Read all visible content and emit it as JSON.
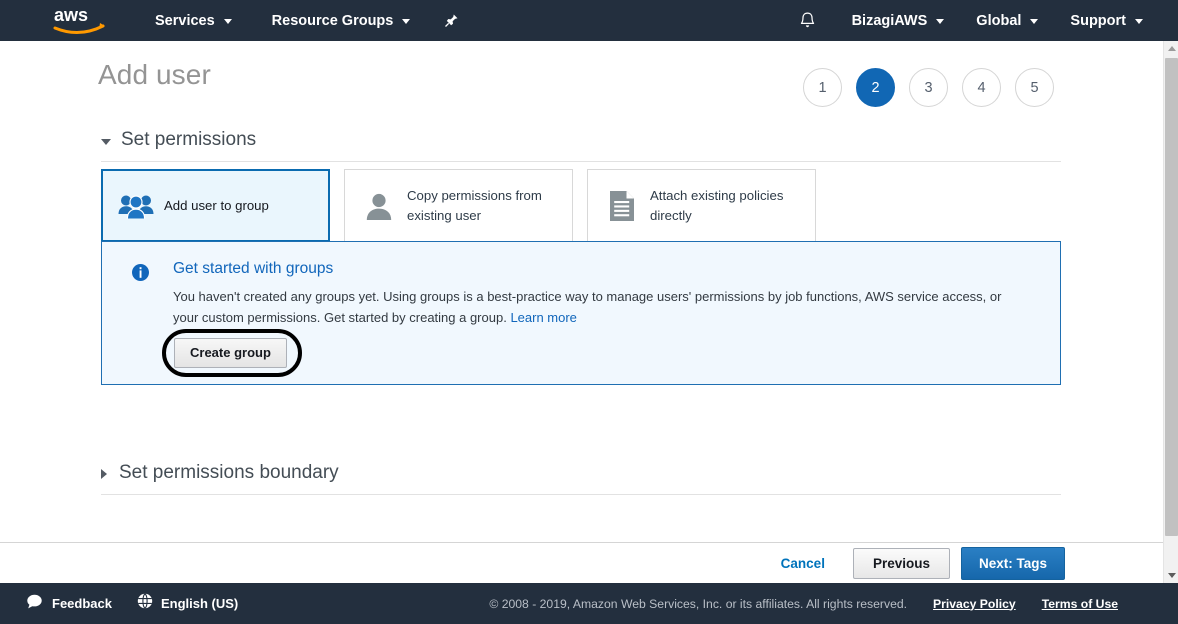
{
  "topnav": {
    "logo_alt": "aws",
    "services_label": "Services",
    "resource_groups_label": "Resource Groups",
    "pin_icon": "pin-icon",
    "bell_icon": "bell-icon",
    "account_label": "BizagiAWS",
    "region_label": "Global",
    "support_label": "Support"
  },
  "page": {
    "title": "Add user",
    "steps": [
      {
        "number": "1",
        "active": false
      },
      {
        "number": "2",
        "active": true
      },
      {
        "number": "3",
        "active": false
      },
      {
        "number": "4",
        "active": false
      },
      {
        "number": "5",
        "active": false
      }
    ],
    "permissions_section": {
      "title": "Set permissions",
      "expanded": true,
      "options": [
        {
          "label": "Add user to group",
          "icon": "group-users-icon",
          "selected": true
        },
        {
          "label": "Copy permissions from existing user",
          "icon": "person-icon",
          "selected": false
        },
        {
          "label": "Attach existing policies directly",
          "icon": "document-icon",
          "selected": false
        }
      ]
    },
    "info_panel": {
      "icon": "info-circle-icon",
      "title": "Get started with groups",
      "body_text": "You haven't created any groups yet. Using groups is a best-practice way to manage users' permissions by job functions, AWS service access, or your custom permissions. Get started by creating a group. ",
      "learn_more_label": "Learn more",
      "create_group_label": "Create group",
      "highlight": "click-target-ellipse"
    },
    "boundary_section": {
      "title": "Set permissions boundary",
      "expanded": false
    },
    "actions": {
      "cancel_label": "Cancel",
      "previous_label": "Previous",
      "next_label": "Next: Tags"
    }
  },
  "footer": {
    "feedback_label": "Feedback",
    "feedback_icon": "speech-bubble-icon",
    "language_label": "English (US)",
    "language_icon": "globe-icon",
    "copyright": "© 2008 - 2019, Amazon Web Services, Inc. or its affiliates. All rights reserved.",
    "privacy_label": "Privacy Policy",
    "terms_label": "Terms of Use"
  },
  "colors": {
    "nav_background": "#232f3e",
    "accent_blue": "#1167b4",
    "link_blue": "#0073bb",
    "info_background": "#f1f8fe",
    "info_border": "#1f6fb2",
    "selected_card_background": "#eaf6fd"
  }
}
